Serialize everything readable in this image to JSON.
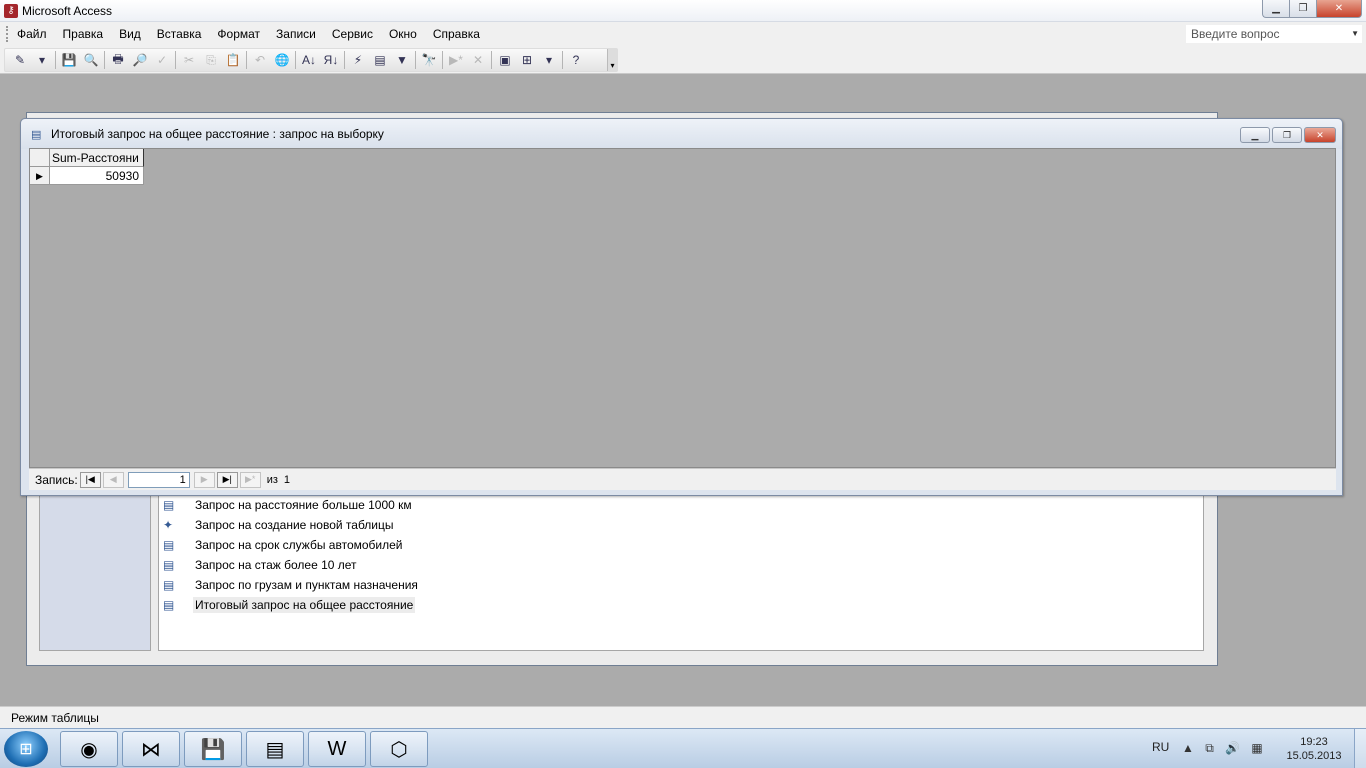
{
  "app": {
    "title": "Microsoft Access",
    "icon": "access-key-icon"
  },
  "window_controls": {
    "minimize": "▁",
    "maximize": "❐",
    "close": "✕"
  },
  "menu": {
    "items": [
      "Файл",
      "Правка",
      "Вид",
      "Вставка",
      "Формат",
      "Записи",
      "Сервис",
      "Окно",
      "Справка"
    ],
    "help_placeholder": "Введите вопрос"
  },
  "toolbar": {
    "icons": [
      {
        "name": "view-icon",
        "glyph": "✎",
        "enabled": true
      },
      {
        "name": "dropdown-arrow-icon",
        "glyph": "▾",
        "enabled": true
      },
      {
        "name": "save-icon",
        "glyph": "💾",
        "enabled": true
      },
      {
        "name": "file-search-icon",
        "glyph": "🔍",
        "enabled": true
      },
      {
        "name": "print-icon",
        "glyph": "🖶",
        "enabled": true
      },
      {
        "name": "print-preview-icon",
        "glyph": "🔎",
        "enabled": true
      },
      {
        "name": "spelling-icon",
        "glyph": "✓",
        "enabled": false
      },
      {
        "name": "cut-icon",
        "glyph": "✂",
        "enabled": false
      },
      {
        "name": "copy-icon",
        "glyph": "⎘",
        "enabled": false
      },
      {
        "name": "paste-icon",
        "glyph": "📋",
        "enabled": false
      },
      {
        "name": "undo-icon",
        "glyph": "↶",
        "enabled": false
      },
      {
        "name": "hyperlink-icon",
        "glyph": "🌐",
        "enabled": false
      },
      {
        "name": "sort-ascending-icon",
        "glyph": "A↓",
        "enabled": true
      },
      {
        "name": "sort-descending-icon",
        "glyph": "Я↓",
        "enabled": true
      },
      {
        "name": "filter-by-selection-icon",
        "glyph": "⚡",
        "enabled": true
      },
      {
        "name": "filter-by-form-icon",
        "glyph": "▤",
        "enabled": true
      },
      {
        "name": "apply-filter-icon",
        "glyph": "▼",
        "enabled": true
      },
      {
        "name": "find-icon",
        "glyph": "🔭",
        "enabled": true
      },
      {
        "name": "new-record-icon",
        "glyph": "▶*",
        "enabled": false
      },
      {
        "name": "delete-record-icon",
        "glyph": "✕",
        "enabled": false
      },
      {
        "name": "database-window-icon",
        "glyph": "▣",
        "enabled": true
      },
      {
        "name": "new-object-icon",
        "glyph": "⊞",
        "enabled": true
      },
      {
        "name": "new-object-dropdown-icon",
        "glyph": "▾",
        "enabled": true
      },
      {
        "name": "help-icon",
        "glyph": "?",
        "enabled": true
      }
    ]
  },
  "query_window": {
    "title": "Итоговый запрос на общее расстояние : запрос на выборку",
    "column_header": "Sum-Расстояни",
    "row_value": "50930",
    "record_label": "Запись:",
    "current_record": "1",
    "of_label": "из",
    "total_records": "1"
  },
  "db_window": {
    "items": [
      {
        "label": "Запрос на расстояние больше 1000 км",
        "icon": "select-query-icon",
        "glyph": "▤"
      },
      {
        "label": "Запрос на создание новой таблицы",
        "icon": "make-table-query-icon",
        "glyph": "✦"
      },
      {
        "label": "Запрос на срок службы автомобилей",
        "icon": "select-query-icon",
        "glyph": "▤"
      },
      {
        "label": "Запрос на стаж более 10 лет",
        "icon": "select-query-icon",
        "glyph": "▤"
      },
      {
        "label": "Запрос по грузам и пунктам назначения",
        "icon": "select-query-icon",
        "glyph": "▤"
      },
      {
        "label": "Итоговый запрос на общее расстояние",
        "icon": "select-query-icon",
        "glyph": "▤",
        "selected": true
      }
    ]
  },
  "status": {
    "text": "Режим таблицы"
  },
  "taskbar": {
    "apps": [
      {
        "name": "chrome-icon",
        "glyph": "◉"
      },
      {
        "name": "visual-studio-icon",
        "glyph": "⋈"
      },
      {
        "name": "access-save-icon",
        "glyph": "💾"
      },
      {
        "name": "query-window-icon",
        "glyph": "▤"
      },
      {
        "name": "word-icon",
        "glyph": "W"
      },
      {
        "name": "pdf-icon",
        "glyph": "⬡"
      }
    ],
    "language": "RU",
    "time": "19:23",
    "date": "15.05.2013"
  }
}
